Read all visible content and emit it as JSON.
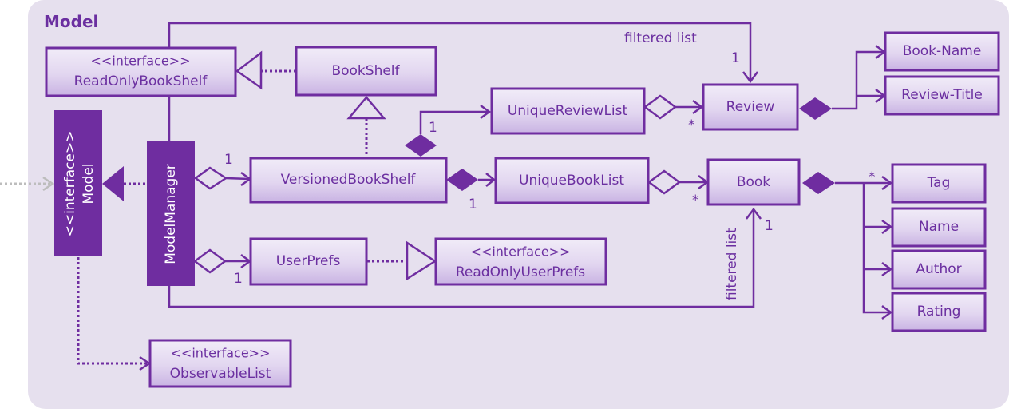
{
  "diagram": {
    "package_title": "Model",
    "colors": {
      "primary": "#6f2da0",
      "box_fill_top": "#f1ecf8",
      "box_fill_bottom": "#c9b3e3",
      "background": "#e6e0ee",
      "external_arrow": "#bdbdbd"
    },
    "classes": {
      "read_only_book_shelf": {
        "stereotype": "<<interface>>",
        "name": "ReadOnlyBookShelf"
      },
      "book_shelf": {
        "name": "BookShelf"
      },
      "model": {
        "stereotype": "<<interface>>",
        "name": "Model"
      },
      "model_manager": {
        "name": "ModelManager"
      },
      "versioned_book_shelf": {
        "name": "VersionedBookShelf"
      },
      "unique_review_list": {
        "name": "UniqueReviewList"
      },
      "review": {
        "name": "Review"
      },
      "book_name": {
        "name": "Book-Name"
      },
      "review_title": {
        "name": "Review-Title"
      },
      "unique_book_list": {
        "name": "UniqueBookList"
      },
      "book": {
        "name": "Book"
      },
      "tag": {
        "name": "Tag"
      },
      "name": {
        "name": "Name"
      },
      "author": {
        "name": "Author"
      },
      "rating": {
        "name": "Rating"
      },
      "user_prefs": {
        "name": "UserPrefs"
      },
      "read_only_user_prefs": {
        "stereotype": "<<interface>>",
        "name": "ReadOnlyUserPrefs"
      },
      "observable_list": {
        "stereotype": "<<interface>>",
        "name": "ObservableList"
      }
    },
    "labels": {
      "filtered_list_top": "filtered list",
      "filtered_list_side": "filtered list",
      "mult_review_one": "1",
      "mult_review_star": "*",
      "mult_urlist_one": "1",
      "mult_vbs_one": "1",
      "mult_ubl_one": "1",
      "mult_book_star": "*",
      "mult_book_one": "1",
      "mult_tag_star": "*",
      "mult_userprefs_one": "1"
    }
  }
}
